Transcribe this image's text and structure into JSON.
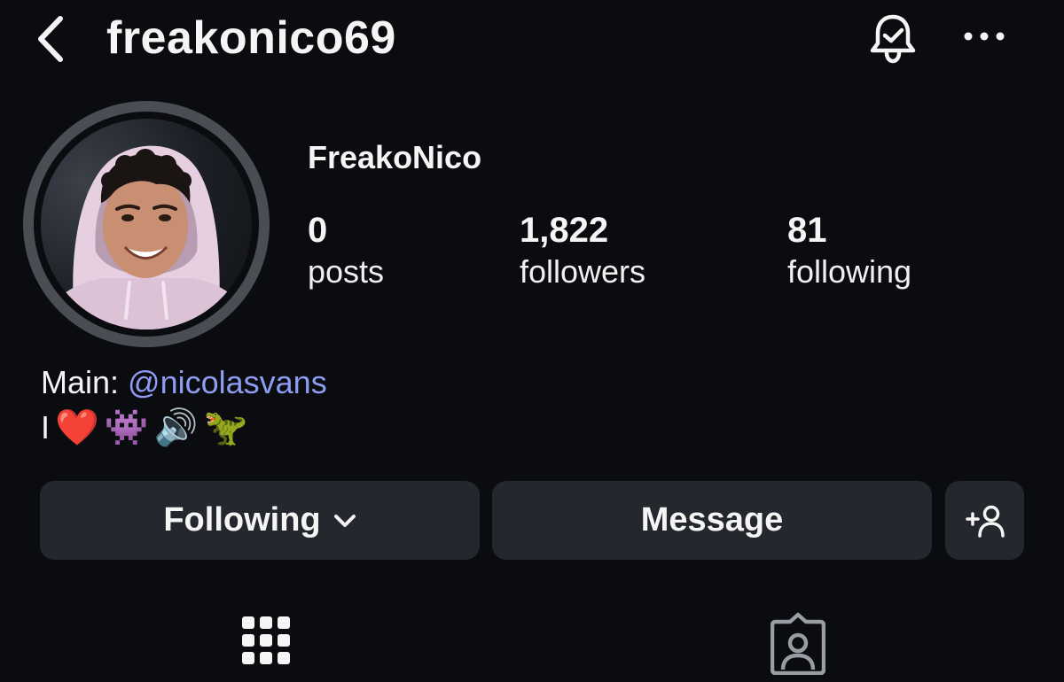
{
  "header": {
    "username": "freakonico69",
    "icons": {
      "back": "chevron-left-icon",
      "notifications": "bell-check-icon",
      "more": "more-horizontal-icon"
    }
  },
  "profile": {
    "display_name": "FreakoNico",
    "avatar": "profile-photo"
  },
  "stats": [
    {
      "value": "0",
      "label": "posts"
    },
    {
      "value": "1,822",
      "label": "followers"
    },
    {
      "value": "81",
      "label": "following"
    }
  ],
  "bio": {
    "prefix": "Main: ",
    "mention": "@nicolasvans",
    "line2_text": "I",
    "emojis": [
      "❤️",
      "👾",
      "🔊",
      "🦖"
    ]
  },
  "actions": {
    "following_label": "Following",
    "message_label": "Message",
    "add_person_icon": "add-person-icon"
  },
  "tabs": {
    "grid_icon": "grid-icon",
    "tagged_icon": "tagged-icon"
  },
  "colors": {
    "background": "#0b0c10",
    "button": "#25272e",
    "mention": "#8e9cf2",
    "avatar_ring": "#4b4d55"
  }
}
